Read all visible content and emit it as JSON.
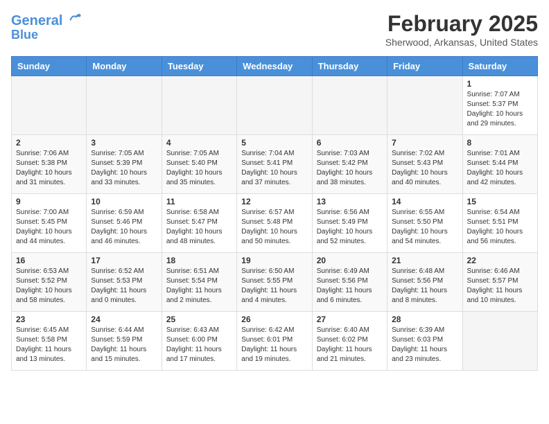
{
  "header": {
    "logo_line1": "General",
    "logo_line2": "Blue",
    "month": "February 2025",
    "location": "Sherwood, Arkansas, United States"
  },
  "days_of_week": [
    "Sunday",
    "Monday",
    "Tuesday",
    "Wednesday",
    "Thursday",
    "Friday",
    "Saturday"
  ],
  "weeks": [
    [
      {
        "day": "",
        "info": ""
      },
      {
        "day": "",
        "info": ""
      },
      {
        "day": "",
        "info": ""
      },
      {
        "day": "",
        "info": ""
      },
      {
        "day": "",
        "info": ""
      },
      {
        "day": "",
        "info": ""
      },
      {
        "day": "1",
        "info": "Sunrise: 7:07 AM\nSunset: 5:37 PM\nDaylight: 10 hours and 29 minutes."
      }
    ],
    [
      {
        "day": "2",
        "info": "Sunrise: 7:06 AM\nSunset: 5:38 PM\nDaylight: 10 hours and 31 minutes."
      },
      {
        "day": "3",
        "info": "Sunrise: 7:05 AM\nSunset: 5:39 PM\nDaylight: 10 hours and 33 minutes."
      },
      {
        "day": "4",
        "info": "Sunrise: 7:05 AM\nSunset: 5:40 PM\nDaylight: 10 hours and 35 minutes."
      },
      {
        "day": "5",
        "info": "Sunrise: 7:04 AM\nSunset: 5:41 PM\nDaylight: 10 hours and 37 minutes."
      },
      {
        "day": "6",
        "info": "Sunrise: 7:03 AM\nSunset: 5:42 PM\nDaylight: 10 hours and 38 minutes."
      },
      {
        "day": "7",
        "info": "Sunrise: 7:02 AM\nSunset: 5:43 PM\nDaylight: 10 hours and 40 minutes."
      },
      {
        "day": "8",
        "info": "Sunrise: 7:01 AM\nSunset: 5:44 PM\nDaylight: 10 hours and 42 minutes."
      }
    ],
    [
      {
        "day": "9",
        "info": "Sunrise: 7:00 AM\nSunset: 5:45 PM\nDaylight: 10 hours and 44 minutes."
      },
      {
        "day": "10",
        "info": "Sunrise: 6:59 AM\nSunset: 5:46 PM\nDaylight: 10 hours and 46 minutes."
      },
      {
        "day": "11",
        "info": "Sunrise: 6:58 AM\nSunset: 5:47 PM\nDaylight: 10 hours and 48 minutes."
      },
      {
        "day": "12",
        "info": "Sunrise: 6:57 AM\nSunset: 5:48 PM\nDaylight: 10 hours and 50 minutes."
      },
      {
        "day": "13",
        "info": "Sunrise: 6:56 AM\nSunset: 5:49 PM\nDaylight: 10 hours and 52 minutes."
      },
      {
        "day": "14",
        "info": "Sunrise: 6:55 AM\nSunset: 5:50 PM\nDaylight: 10 hours and 54 minutes."
      },
      {
        "day": "15",
        "info": "Sunrise: 6:54 AM\nSunset: 5:51 PM\nDaylight: 10 hours and 56 minutes."
      }
    ],
    [
      {
        "day": "16",
        "info": "Sunrise: 6:53 AM\nSunset: 5:52 PM\nDaylight: 10 hours and 58 minutes."
      },
      {
        "day": "17",
        "info": "Sunrise: 6:52 AM\nSunset: 5:53 PM\nDaylight: 11 hours and 0 minutes."
      },
      {
        "day": "18",
        "info": "Sunrise: 6:51 AM\nSunset: 5:54 PM\nDaylight: 11 hours and 2 minutes."
      },
      {
        "day": "19",
        "info": "Sunrise: 6:50 AM\nSunset: 5:55 PM\nDaylight: 11 hours and 4 minutes."
      },
      {
        "day": "20",
        "info": "Sunrise: 6:49 AM\nSunset: 5:56 PM\nDaylight: 11 hours and 6 minutes."
      },
      {
        "day": "21",
        "info": "Sunrise: 6:48 AM\nSunset: 5:56 PM\nDaylight: 11 hours and 8 minutes."
      },
      {
        "day": "22",
        "info": "Sunrise: 6:46 AM\nSunset: 5:57 PM\nDaylight: 11 hours and 10 minutes."
      }
    ],
    [
      {
        "day": "23",
        "info": "Sunrise: 6:45 AM\nSunset: 5:58 PM\nDaylight: 11 hours and 13 minutes."
      },
      {
        "day": "24",
        "info": "Sunrise: 6:44 AM\nSunset: 5:59 PM\nDaylight: 11 hours and 15 minutes."
      },
      {
        "day": "25",
        "info": "Sunrise: 6:43 AM\nSunset: 6:00 PM\nDaylight: 11 hours and 17 minutes."
      },
      {
        "day": "26",
        "info": "Sunrise: 6:42 AM\nSunset: 6:01 PM\nDaylight: 11 hours and 19 minutes."
      },
      {
        "day": "27",
        "info": "Sunrise: 6:40 AM\nSunset: 6:02 PM\nDaylight: 11 hours and 21 minutes."
      },
      {
        "day": "28",
        "info": "Sunrise: 6:39 AM\nSunset: 6:03 PM\nDaylight: 11 hours and 23 minutes."
      },
      {
        "day": "",
        "info": ""
      }
    ]
  ]
}
